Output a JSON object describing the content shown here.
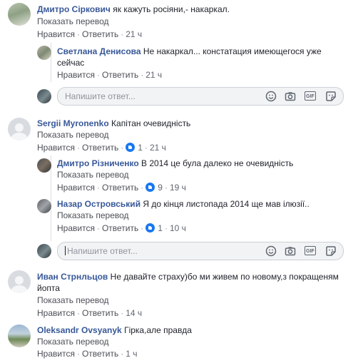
{
  "comments": [
    {
      "author": "Дмитро Сіркович",
      "text": "як кажуть росіяни,- накаркал.",
      "translate": "Показать перевод",
      "like": "Нравится",
      "reply": "Ответить",
      "time": "21 ч",
      "replies": [
        {
          "author": "Светлана Денисова",
          "text": "Не накаркал... констатация имеющегося уже",
          "text2": "сейчас",
          "like": "Нравится",
          "reply": "Ответить",
          "time": "21 ч"
        }
      ],
      "reply_placeholder": "Напишите ответ..."
    },
    {
      "author": "Sergii Myronenko",
      "text": "Капітан очевидність",
      "translate": "Показать перевод",
      "like": "Нравится",
      "reply": "Ответить",
      "likes": "1",
      "time": "21 ч",
      "replies": [
        {
          "author": "Дмитро Різниченко",
          "text": "В 2014 це була далеко не очевидність",
          "translate": "Показать перевод",
          "like": "Нравится",
          "reply": "Ответить",
          "likes": "9",
          "time": "19 ч"
        },
        {
          "author": "Назар Островський",
          "text": "Я до кінця листопада 2014 ще мав ілюзії..",
          "translate": "Показать перевод",
          "like": "Нравится",
          "reply": "Ответить",
          "likes": "1",
          "time": "10 ч"
        }
      ],
      "reply_placeholder": "Напишите ответ..."
    },
    {
      "author": "Иван Стрнльцов",
      "text": "Не давайте страху)бо ми живем по новому,з покращеням",
      "text2": "йопта",
      "translate": "Показать перевод",
      "like": "Нравится",
      "reply": "Ответить",
      "time": "14 ч"
    },
    {
      "author": "Oleksandr Ovsyanyk",
      "text": "Гірка,але правда",
      "translate": "Показать перевод",
      "like": "Нравится",
      "reply": "Ответить",
      "time": "1 ч"
    }
  ],
  "icons": {
    "emoji": "emoji-icon",
    "camera": "camera-icon",
    "gif": "gif-icon",
    "sticker": "sticker-icon",
    "like": "like-reaction-icon"
  },
  "gif_label": "GIF",
  "colors": {
    "name": "#385898",
    "like_blue": "#1877f2",
    "meta": "#606770"
  }
}
